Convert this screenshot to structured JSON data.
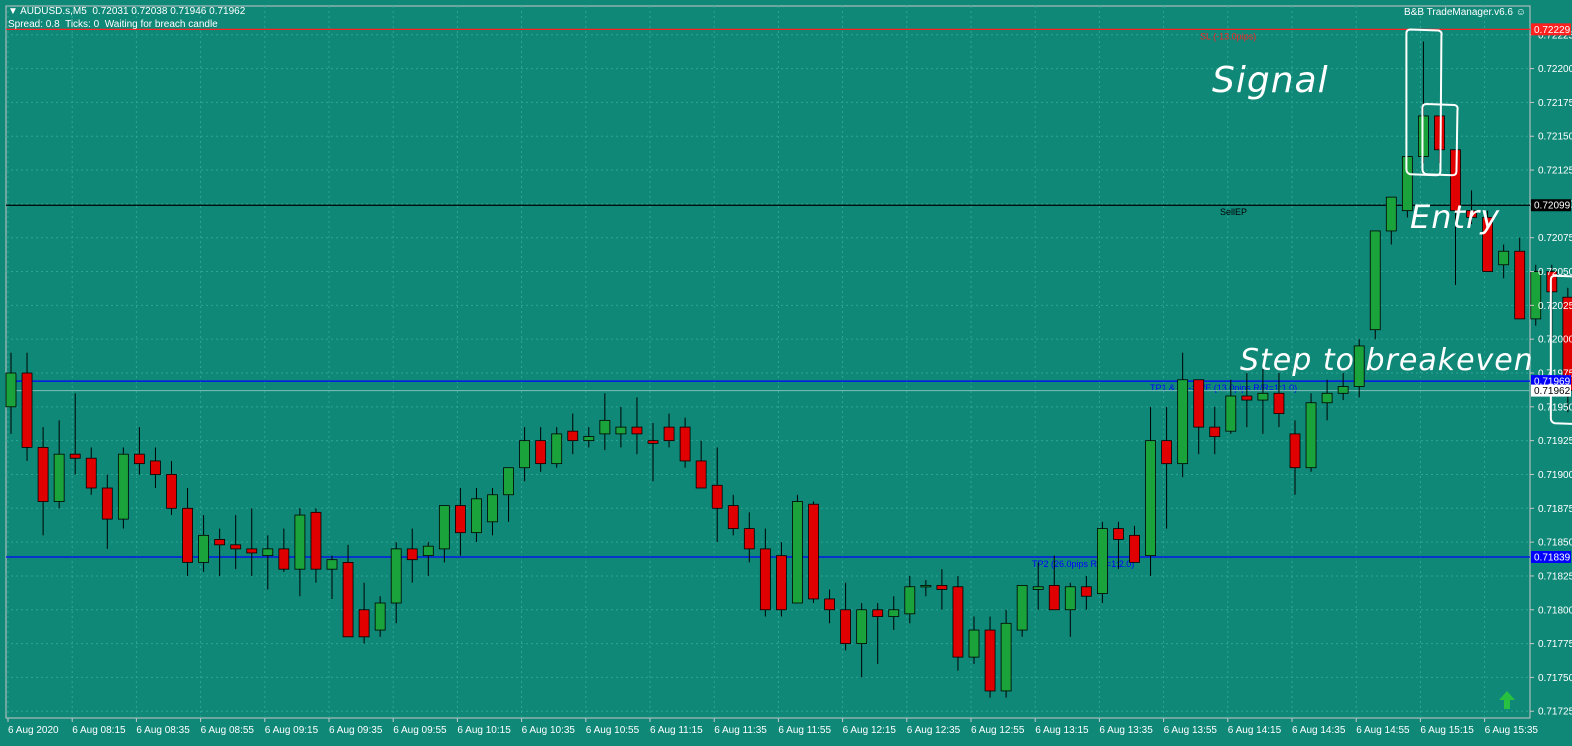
{
  "header": {
    "symbol_line": "▼ AUDUSD.s,M5  0.72031 0.72038 0.71946 0.71962",
    "status_line": "Spread: 0.8  Ticks: 0  Waiting for breach candle",
    "trade_manager": "B&B TradeManager.v6.6"
  },
  "colors": {
    "background": "#0f8878",
    "bull": "#1aa33a",
    "bear": "#e00000",
    "sl_line": "#ff2020",
    "tp_line": "#0000ff",
    "entry_line": "#000000",
    "grid": "#2fa595"
  },
  "chart_data": {
    "type": "candlestick",
    "symbol": "AUDUSD.s",
    "timeframe": "M5",
    "ylim": [
      0.7172,
      0.7223
    ],
    "y_ticks": [
      "0.71725",
      "0.71750",
      "0.71775",
      "0.71800",
      "0.71825",
      "0.71850",
      "0.71875",
      "0.71900",
      "0.71925",
      "0.71950",
      "0.71975",
      "0.72000",
      "0.72025",
      "0.72050",
      "0.72075",
      "0.72100",
      "0.72125",
      "0.72150",
      "0.72175",
      "0.72200",
      "0.72225"
    ],
    "x_ticks": [
      "6 Aug 2020",
      "6 Aug 08:15",
      "6 Aug 08:35",
      "6 Aug 08:55",
      "6 Aug 09:15",
      "6 Aug 09:35",
      "6 Aug 09:55",
      "6 Aug 10:15",
      "6 Aug 10:35",
      "6 Aug 10:55",
      "6 Aug 11:15",
      "6 Aug 11:35",
      "6 Aug 11:55",
      "6 Aug 12:15",
      "6 Aug 12:35",
      "6 Aug 12:55",
      "6 Aug 13:15",
      "6 Aug 13:35",
      "6 Aug 13:55",
      "6 Aug 14:15",
      "6 Aug 14:35",
      "6 Aug 14:55",
      "6 Aug 15:15",
      "6 Aug 15:35"
    ],
    "candles": [
      {
        "o": 0.7195,
        "h": 0.7199,
        "l": 0.7193,
        "c": 0.71975
      },
      {
        "o": 0.71975,
        "h": 0.7199,
        "l": 0.7191,
        "c": 0.7192
      },
      {
        "o": 0.7192,
        "h": 0.71935,
        "l": 0.71855,
        "c": 0.7188
      },
      {
        "o": 0.7188,
        "h": 0.7194,
        "l": 0.71875,
        "c": 0.71915
      },
      {
        "o": 0.71915,
        "h": 0.7196,
        "l": 0.719,
        "c": 0.71912
      },
      {
        "o": 0.71912,
        "h": 0.7192,
        "l": 0.71885,
        "c": 0.7189
      },
      {
        "o": 0.7189,
        "h": 0.719,
        "l": 0.71845,
        "c": 0.71867
      },
      {
        "o": 0.71867,
        "h": 0.7192,
        "l": 0.7186,
        "c": 0.71915
      },
      {
        "o": 0.71915,
        "h": 0.71935,
        "l": 0.719,
        "c": 0.71908
      },
      {
        "o": 0.7191,
        "h": 0.7192,
        "l": 0.7189,
        "c": 0.719
      },
      {
        "o": 0.719,
        "h": 0.7191,
        "l": 0.7187,
        "c": 0.71875
      },
      {
        "o": 0.71875,
        "h": 0.7189,
        "l": 0.71825,
        "c": 0.71835
      },
      {
        "o": 0.71835,
        "h": 0.7187,
        "l": 0.71828,
        "c": 0.71855
      },
      {
        "o": 0.71852,
        "h": 0.7186,
        "l": 0.71825,
        "c": 0.71848
      },
      {
        "o": 0.71848,
        "h": 0.7187,
        "l": 0.7183,
        "c": 0.71845
      },
      {
        "o": 0.71845,
        "h": 0.71875,
        "l": 0.71825,
        "c": 0.71842
      },
      {
        "o": 0.7184,
        "h": 0.71855,
        "l": 0.71815,
        "c": 0.71845
      },
      {
        "o": 0.71845,
        "h": 0.7186,
        "l": 0.71828,
        "c": 0.7183
      },
      {
        "o": 0.7183,
        "h": 0.71875,
        "l": 0.7181,
        "c": 0.7187
      },
      {
        "o": 0.71872,
        "h": 0.71875,
        "l": 0.7182,
        "c": 0.7183
      },
      {
        "o": 0.7183,
        "h": 0.7184,
        "l": 0.71808,
        "c": 0.71837
      },
      {
        "o": 0.71835,
        "h": 0.71848,
        "l": 0.71795,
        "c": 0.7178
      },
      {
        "o": 0.718,
        "h": 0.7182,
        "l": 0.71775,
        "c": 0.7178
      },
      {
        "o": 0.71785,
        "h": 0.7181,
        "l": 0.7178,
        "c": 0.71805
      },
      {
        "o": 0.71805,
        "h": 0.7185,
        "l": 0.7179,
        "c": 0.71845
      },
      {
        "o": 0.71845,
        "h": 0.7186,
        "l": 0.7182,
        "c": 0.71837
      },
      {
        "o": 0.7184,
        "h": 0.7185,
        "l": 0.71825,
        "c": 0.71847
      },
      {
        "o": 0.71845,
        "h": 0.7187,
        "l": 0.71835,
        "c": 0.71877
      },
      {
        "o": 0.71877,
        "h": 0.7189,
        "l": 0.7184,
        "c": 0.71857
      },
      {
        "o": 0.71857,
        "h": 0.7189,
        "l": 0.7185,
        "c": 0.71882
      },
      {
        "o": 0.71865,
        "h": 0.7189,
        "l": 0.71855,
        "c": 0.71885
      },
      {
        "o": 0.71885,
        "h": 0.719,
        "l": 0.71865,
        "c": 0.71905
      },
      {
        "o": 0.71905,
        "h": 0.71935,
        "l": 0.71895,
        "c": 0.71925
      },
      {
        "o": 0.71925,
        "h": 0.71935,
        "l": 0.71902,
        "c": 0.71908
      },
      {
        "o": 0.71908,
        "h": 0.71935,
        "l": 0.71905,
        "c": 0.7193
      },
      {
        "o": 0.71932,
        "h": 0.71945,
        "l": 0.71915,
        "c": 0.71925
      },
      {
        "o": 0.71925,
        "h": 0.71935,
        "l": 0.7192,
        "c": 0.71928
      },
      {
        "o": 0.7193,
        "h": 0.7196,
        "l": 0.71918,
        "c": 0.7194
      },
      {
        "o": 0.7193,
        "h": 0.7195,
        "l": 0.7192,
        "c": 0.71935
      },
      {
        "o": 0.71935,
        "h": 0.71957,
        "l": 0.71915,
        "c": 0.7193
      },
      {
        "o": 0.71925,
        "h": 0.71938,
        "l": 0.71895,
        "c": 0.71923
      },
      {
        "o": 0.71935,
        "h": 0.71945,
        "l": 0.7192,
        "c": 0.71925
      },
      {
        "o": 0.71935,
        "h": 0.71942,
        "l": 0.71905,
        "c": 0.7191
      },
      {
        "o": 0.7191,
        "h": 0.71925,
        "l": 0.71895,
        "c": 0.7189
      },
      {
        "o": 0.71892,
        "h": 0.7192,
        "l": 0.7185,
        "c": 0.71875
      },
      {
        "o": 0.71877,
        "h": 0.71885,
        "l": 0.71855,
        "c": 0.7186
      },
      {
        "o": 0.7186,
        "h": 0.71872,
        "l": 0.71835,
        "c": 0.71845
      },
      {
        "o": 0.71845,
        "h": 0.7186,
        "l": 0.71795,
        "c": 0.718
      },
      {
        "o": 0.7184,
        "h": 0.7185,
        "l": 0.71795,
        "c": 0.718
      },
      {
        "o": 0.71805,
        "h": 0.71885,
        "l": 0.71815,
        "c": 0.7188
      },
      {
        "o": 0.71878,
        "h": 0.7188,
        "l": 0.71805,
        "c": 0.71808
      },
      {
        "o": 0.71808,
        "h": 0.71815,
        "l": 0.7179,
        "c": 0.718
      },
      {
        "o": 0.718,
        "h": 0.7182,
        "l": 0.7177,
        "c": 0.71775
      },
      {
        "o": 0.71775,
        "h": 0.71805,
        "l": 0.7175,
        "c": 0.718
      },
      {
        "o": 0.718,
        "h": 0.71805,
        "l": 0.7176,
        "c": 0.71795
      },
      {
        "o": 0.71795,
        "h": 0.7181,
        "l": 0.71785,
        "c": 0.718
      },
      {
        "o": 0.71797,
        "h": 0.71825,
        "l": 0.7179,
        "c": 0.71817
      },
      {
        "o": 0.71817,
        "h": 0.71822,
        "l": 0.7181,
        "c": 0.71818
      },
      {
        "o": 0.71818,
        "h": 0.7183,
        "l": 0.718,
        "c": 0.71815
      },
      {
        "o": 0.71817,
        "h": 0.71825,
        "l": 0.71755,
        "c": 0.71765
      },
      {
        "o": 0.71765,
        "h": 0.71795,
        "l": 0.7176,
        "c": 0.71785
      },
      {
        "o": 0.71785,
        "h": 0.71795,
        "l": 0.71735,
        "c": 0.7174
      },
      {
        "o": 0.7174,
        "h": 0.718,
        "l": 0.71735,
        "c": 0.7179
      },
      {
        "o": 0.71785,
        "h": 0.718,
        "l": 0.7178,
        "c": 0.71818
      },
      {
        "o": 0.71815,
        "h": 0.71835,
        "l": 0.718,
        "c": 0.71817
      },
      {
        "o": 0.71818,
        "h": 0.7184,
        "l": 0.71805,
        "c": 0.718
      },
      {
        "o": 0.718,
        "h": 0.7182,
        "l": 0.7178,
        "c": 0.71817
      },
      {
        "o": 0.71817,
        "h": 0.71825,
        "l": 0.718,
        "c": 0.7181
      },
      {
        "o": 0.71812,
        "h": 0.71865,
        "l": 0.71805,
        "c": 0.7186
      },
      {
        "o": 0.7186,
        "h": 0.71865,
        "l": 0.7183,
        "c": 0.71852
      },
      {
        "o": 0.71855,
        "h": 0.71862,
        "l": 0.7184,
        "c": 0.71835
      },
      {
        "o": 0.7184,
        "h": 0.7195,
        "l": 0.71825,
        "c": 0.71925
      },
      {
        "o": 0.71925,
        "h": 0.7195,
        "l": 0.7186,
        "c": 0.71908
      },
      {
        "o": 0.71908,
        "h": 0.7199,
        "l": 0.71898,
        "c": 0.7197
      },
      {
        "o": 0.7197,
        "h": 0.7197,
        "l": 0.71915,
        "c": 0.71935
      },
      {
        "o": 0.71935,
        "h": 0.7195,
        "l": 0.71915,
        "c": 0.71928
      },
      {
        "o": 0.71932,
        "h": 0.7197,
        "l": 0.7193,
        "c": 0.71958
      },
      {
        "o": 0.71958,
        "h": 0.71975,
        "l": 0.71935,
        "c": 0.71955
      },
      {
        "o": 0.71955,
        "h": 0.71978,
        "l": 0.7193,
        "c": 0.7196
      },
      {
        "o": 0.7196,
        "h": 0.71975,
        "l": 0.71935,
        "c": 0.71945
      },
      {
        "o": 0.7193,
        "h": 0.7194,
        "l": 0.71885,
        "c": 0.71905
      },
      {
        "o": 0.71905,
        "h": 0.7196,
        "l": 0.71902,
        "c": 0.71953
      },
      {
        "o": 0.71953,
        "h": 0.7197,
        "l": 0.7194,
        "c": 0.7196
      },
      {
        "o": 0.7196,
        "h": 0.71975,
        "l": 0.71955,
        "c": 0.71965
      },
      {
        "o": 0.71965,
        "h": 0.72,
        "l": 0.71957,
        "c": 0.71995
      },
      {
        "o": 0.72007,
        "h": 0.7205,
        "l": 0.72,
        "c": 0.7208
      },
      {
        "o": 0.7208,
        "h": 0.7208,
        "l": 0.7207,
        "c": 0.72105
      },
      {
        "o": 0.72095,
        "h": 0.7213,
        "l": 0.7209,
        "c": 0.72135
      },
      {
        "o": 0.72135,
        "h": 0.7222,
        "l": 0.7213,
        "c": 0.72165
      },
      {
        "o": 0.72165,
        "h": 0.72165,
        "l": 0.7213,
        "c": 0.7214
      },
      {
        "o": 0.7214,
        "h": 0.7214,
        "l": 0.7204,
        "c": 0.72095
      },
      {
        "o": 0.72095,
        "h": 0.7211,
        "l": 0.72085,
        "c": 0.7209
      },
      {
        "o": 0.7209,
        "h": 0.72095,
        "l": 0.72065,
        "c": 0.7205
      },
      {
        "o": 0.72055,
        "h": 0.7207,
        "l": 0.72045,
        "c": 0.72065
      },
      {
        "o": 0.72065,
        "h": 0.72075,
        "l": 0.72015,
        "c": 0.72015
      },
      {
        "o": 0.72015,
        "h": 0.72055,
        "l": 0.7201,
        "c": 0.7205
      },
      {
        "o": 0.7205,
        "h": 0.72055,
        "l": 0.72,
        "c": 0.72035
      },
      {
        "o": 0.72031,
        "h": 0.72038,
        "l": 0.71946,
        "c": 0.71962
      }
    ],
    "lines": [
      {
        "name": "SL",
        "price": 0.72229,
        "color": "#ff2020",
        "label": "SL (-13.0pips)",
        "tag": "0.72229"
      },
      {
        "name": "SellEP",
        "price": 0.72099,
        "color": "#000000",
        "label": "SellEP",
        "tag": "0.72099"
      },
      {
        "name": "TP1",
        "price": 0.71969,
        "color": "#0000ff",
        "label": "TP1 & SL->B/E (13.0pips R/R=1:1.0)",
        "tag": "0.71969"
      },
      {
        "name": "TP2",
        "price": 0.71839,
        "color": "#0000ff",
        "label": "TP2 (26.0pips R/R=1:2.0)",
        "tag": "0.71839"
      }
    ],
    "bid_tag": "0.71962",
    "annotations": [
      {
        "text": "Signal",
        "target_candle": 88
      },
      {
        "text": "Entry",
        "target_candle": 89
      },
      {
        "text": "Step to breakeven",
        "target_candle": 97
      }
    ]
  }
}
